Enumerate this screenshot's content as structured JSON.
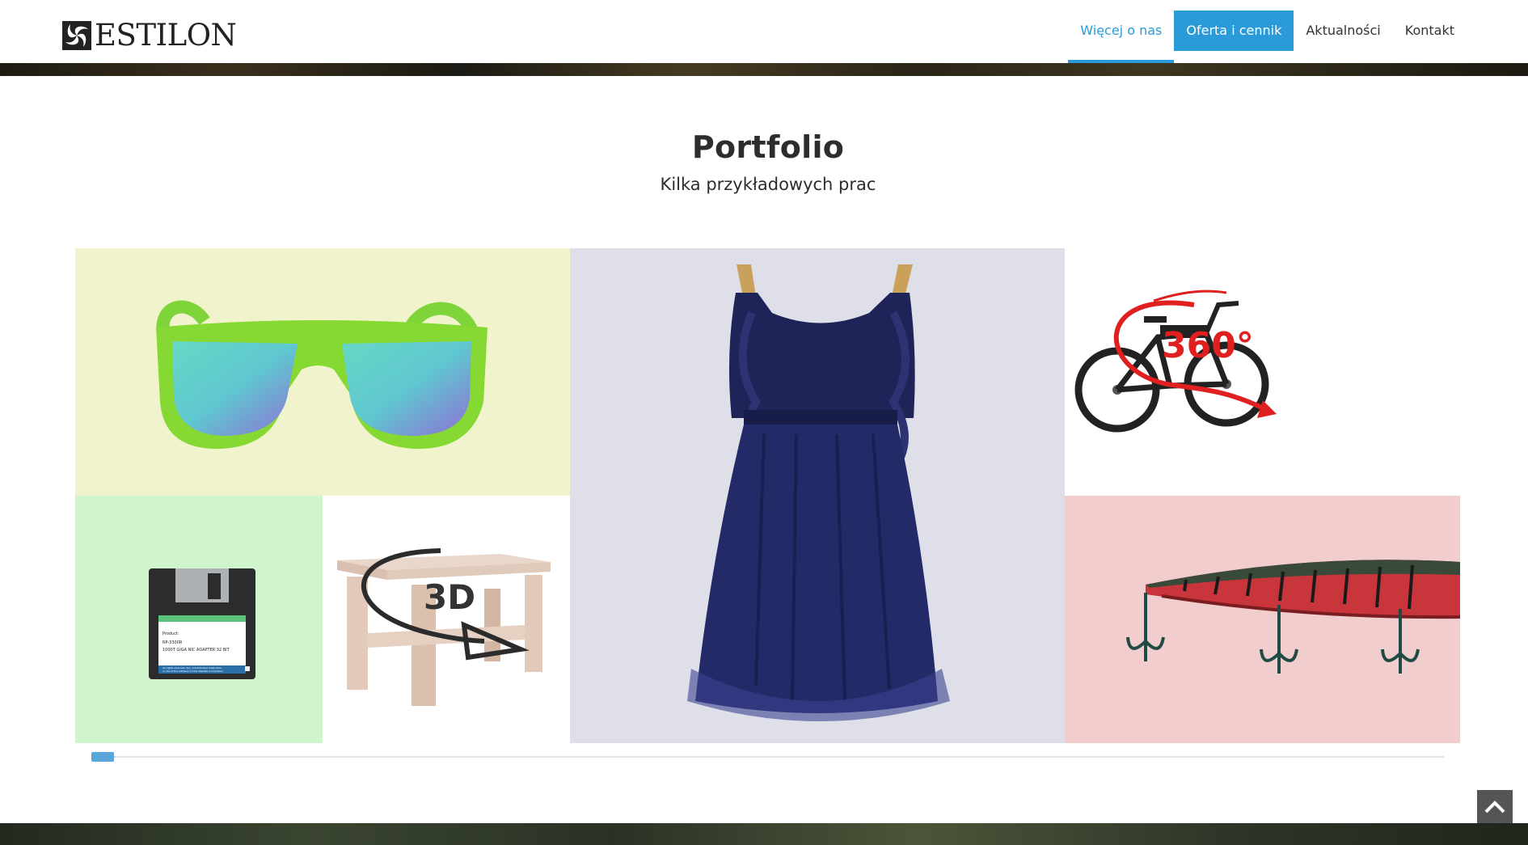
{
  "brand": {
    "name": "ESTILON"
  },
  "nav": {
    "items": [
      {
        "label": "Więcej o nas",
        "state": "active"
      },
      {
        "label": "Oferta i cennik",
        "state": "highlight"
      },
      {
        "label": "Aktualności",
        "state": "normal"
      },
      {
        "label": "Kontakt",
        "state": "normal"
      }
    ]
  },
  "portfolio": {
    "title": "Portfolio",
    "subtitle": "Kilka przykładowych prac",
    "tiles": [
      {
        "subject": "green sunglasses",
        "bg": "#f0f3cb"
      },
      {
        "subject": "floppy disk",
        "bg": "#d0f4cc",
        "lines": [
          "Product:",
          "RP-3300R",
          "1000T GIGA NIC ADAPTER 32 BIT",
          "All rights reserved. Any unauthorized duplication",
          "or use of the software in this diskette is forbidden."
        ]
      },
      {
        "subject": "coffee table 3D",
        "bg": "#ffffff",
        "badge": "3D"
      },
      {
        "subject": "navy dress",
        "bg": "#dfdfe9"
      },
      {
        "subject": "bicycle 360",
        "bg": "#ffffff",
        "badge": "360°"
      },
      {
        "subject": "fishing lure",
        "bg": "#f1cdcd"
      }
    ]
  },
  "colors": {
    "accent": "#2a9bd8",
    "text": "#2d2d2d"
  },
  "icons": {
    "back_to_top": "chevron-up-icon",
    "logo": "estilon-logo-icon"
  }
}
